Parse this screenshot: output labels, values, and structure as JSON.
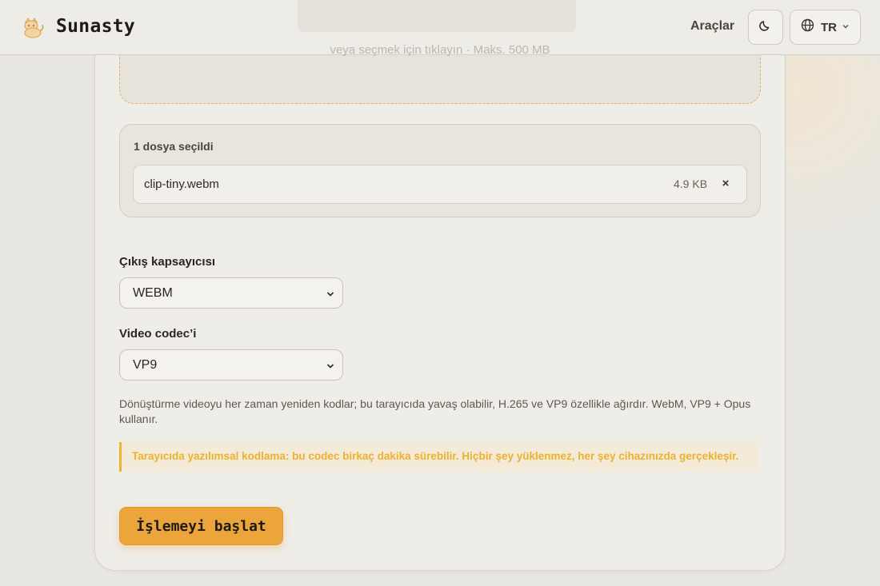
{
  "header": {
    "brand": "Sunasty",
    "nav_tools": "Araçlar",
    "theme_icon": "moon-icon",
    "language": {
      "icon": "globe-icon",
      "code": "TR"
    }
  },
  "upload": {
    "hint": "veya seçmek için tıklayın · Maks. 500 MB"
  },
  "files": {
    "count_label": "1 dosya seçildi",
    "items": [
      {
        "name": "clip-tiny.webm",
        "size": "4.9 KB",
        "remove_label": "×"
      }
    ]
  },
  "form": {
    "container_label": "Çıkış kapsayıcısı",
    "container_value": "WEBM",
    "codec_label": "Video codec’i",
    "codec_value": "VP9",
    "help": "Dönüştürme videoyu her zaman yeniden kodlar; bu tarayıcıda yavaş olabilir, H.265 ve VP9 özellikle ağırdır. WebM, VP9 + Opus kullanır.",
    "warning": "Tarayıcıda yazılımsal kodlama: bu codec birkaç dakika sürebilir. Hiçbir şey yüklenmez, her şey cihazınızda gerçekleşir.",
    "start_label": "İşlemeyi başlat"
  },
  "colors": {
    "accent": "#eca53b",
    "warning_text": "#ecb22e",
    "warning_bar": "#f0b32e",
    "background": "#e9e7e2"
  }
}
